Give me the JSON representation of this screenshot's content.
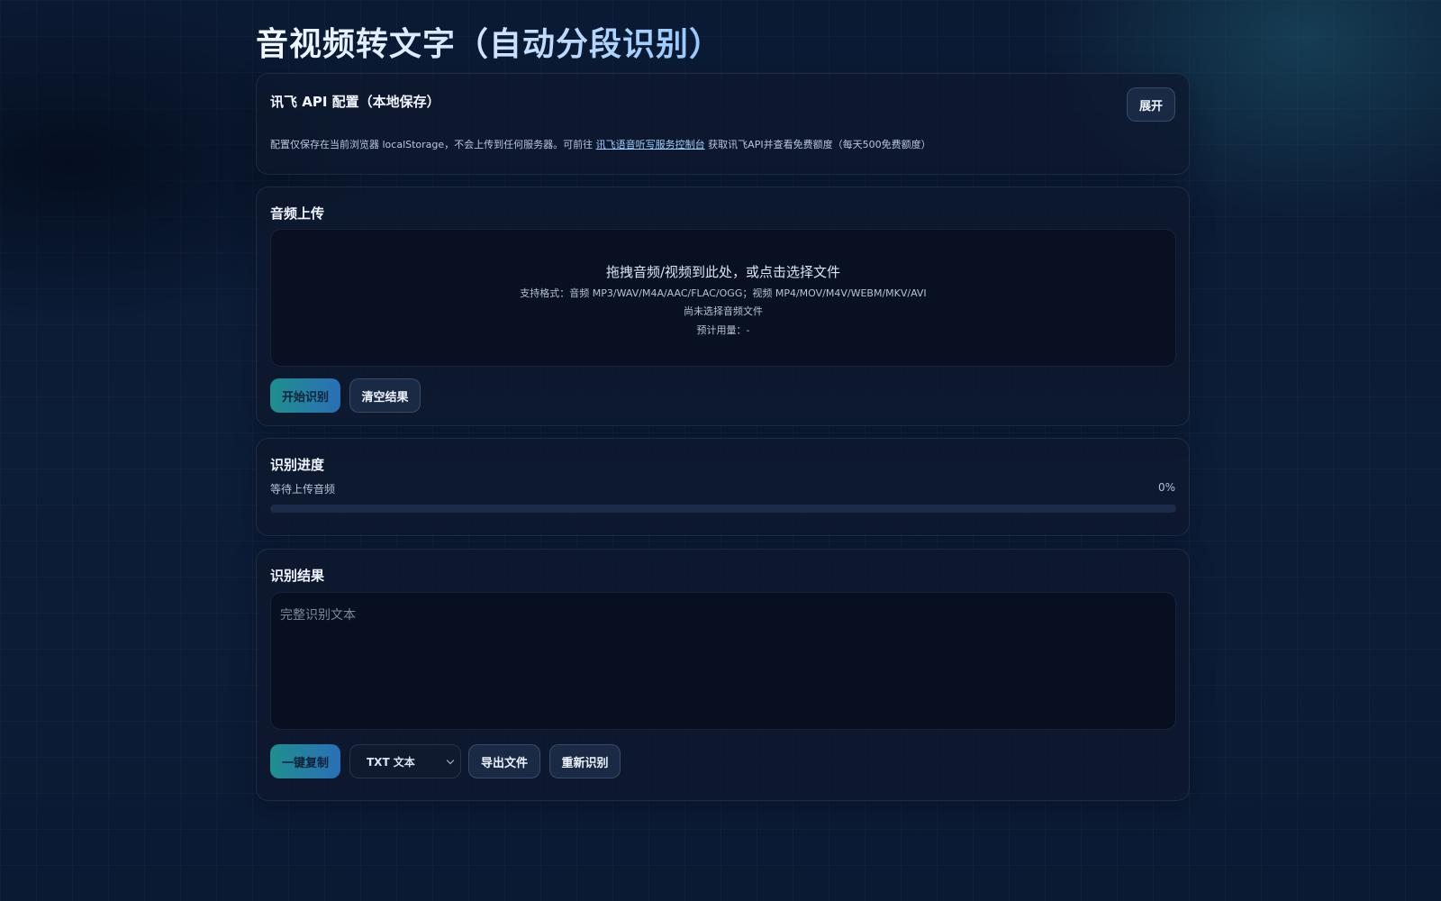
{
  "page": {
    "title": "音视频转文字（自动分段识别）"
  },
  "api_config": {
    "title": "讯飞 API 配置（本地保存）",
    "expand_label": "展开",
    "note_before": "配置仅保存在当前浏览器 localStorage，不会上传到任何服务器。可前往 ",
    "note_link": "讯飞语音听写服务控制台",
    "note_after": " 获取讯飞API并查看免费额度（每天500免费额度）"
  },
  "upload": {
    "title": "音频上传",
    "drop_text": "拖拽音频/视频到此处，或点击选择文件",
    "formats_text": "支持格式：音频 MP3/WAV/M4A/AAC/FLAC/OGG；视频 MP4/MOV/M4V/WEBM/MKV/AVI",
    "file_status": "尚未选择音频文件",
    "usage_text": "预计用量：-",
    "start_label": "开始识别",
    "clear_label": "清空结果"
  },
  "progress": {
    "title": "识别进度",
    "status_text": "等待上传音频",
    "percent_text": "0%",
    "percent_value": 0
  },
  "result": {
    "title": "识别结果",
    "placeholder": "完整识别文本",
    "value": "",
    "copy_label": "一键复制",
    "format_selected": "TXT 文本",
    "export_label": "导出文件",
    "retry_label": "重新识别"
  },
  "colors": {
    "background": "#0b1a33",
    "card": "#0e182c",
    "primary_gradient_start": "#1f8f8f",
    "primary_gradient_end": "#2a6fb6",
    "link": "#9fd0ff"
  }
}
